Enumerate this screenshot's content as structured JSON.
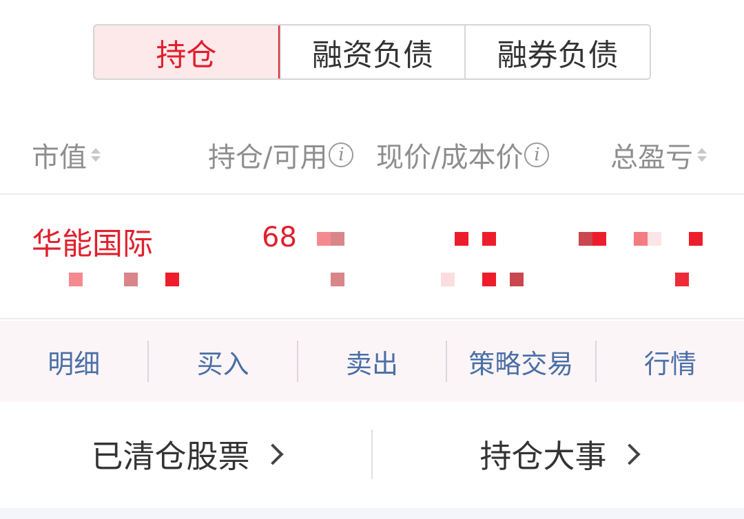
{
  "tabs": [
    {
      "label": "持仓",
      "active": true
    },
    {
      "label": "融资负债",
      "active": false
    },
    {
      "label": "融券负债",
      "active": false
    }
  ],
  "columns": {
    "market_value": "市值",
    "position_available": "持仓/可用",
    "price_cost": "现价/成本价",
    "total_pnl": "总盈亏"
  },
  "holding": {
    "name": "华能国际",
    "quantity": "68"
  },
  "actions": {
    "detail": "明细",
    "buy": "买入",
    "sell": "卖出",
    "strategy": "策略交易",
    "quote": "行情"
  },
  "links": {
    "cleared": "已清仓股票",
    "events": "持仓大事"
  },
  "colors": {
    "accent": "#e0202d",
    "link_blue": "#4a6fa5",
    "header_gray": "#8e8e8e"
  }
}
